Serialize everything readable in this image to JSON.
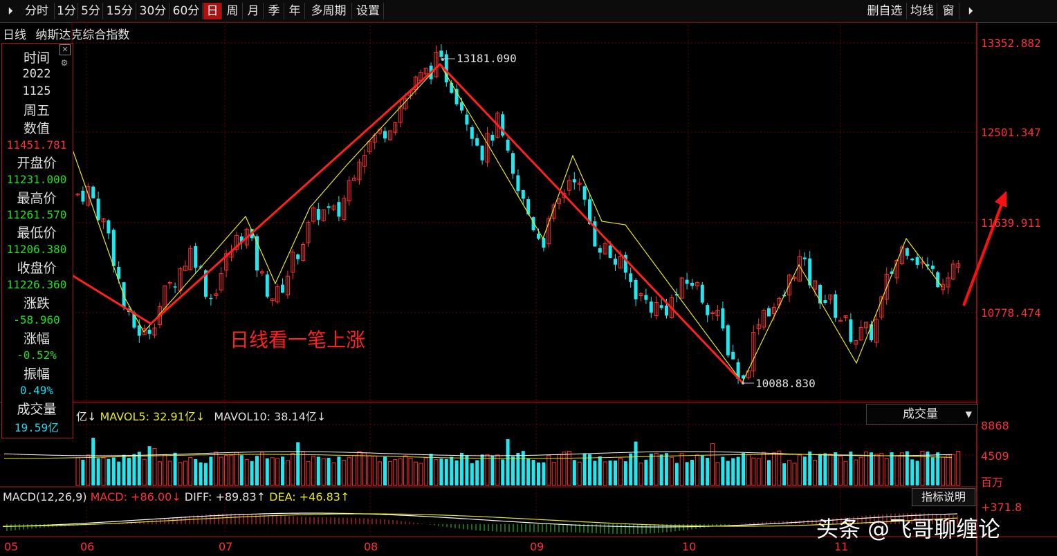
{
  "toolbar": {
    "left_icon": "⏵",
    "periods": [
      "分时",
      "1分",
      "5分",
      "15分",
      "30分",
      "60分",
      "日",
      "周",
      "月",
      "季",
      "年",
      "多周期",
      "设置"
    ],
    "active": "日",
    "right_buttons": [
      "删自选",
      "均线",
      "窗"
    ],
    "right_icon": "⏵"
  },
  "title": {
    "period": "日线",
    "name": "纳斯达克综合指数"
  },
  "info": {
    "time_label": "时间",
    "year": "2022",
    "date": "1125",
    "weekday": "周五",
    "value_label": "数值",
    "value": "11451.781",
    "open_label": "开盘价",
    "open": "11231.000",
    "high_label": "最高价",
    "high": "11261.570",
    "low_label": "最低价",
    "low": "11206.380",
    "close_label": "收盘价",
    "close": "11226.360",
    "change_label": "涨跌",
    "change": "-58.960",
    "pct_label": "涨幅",
    "pct": "-0.52%",
    "amp_label": "振幅",
    "amp": "0.49%",
    "vol_label": "成交量",
    "vol": "19.59亿",
    "close_icon": "close-icon",
    "gear_icon": "gear-icon"
  },
  "price_axis": [
    "13352.882",
    "12501.347",
    "11639.911",
    "10778.474"
  ],
  "annotations": {
    "high": "13181.090",
    "low": "10088.830",
    "text": "日线看一笔上涨"
  },
  "volume": {
    "legend_prefix": "亿↓ ",
    "mavol5": "MAVOL5: 32.91亿↓",
    "mavol10": "MAVOL10: 38.14亿↓",
    "selector": "成交量",
    "axis": [
      "8868",
      "4509",
      "百万"
    ]
  },
  "macd": {
    "name": "MACD(12,26,9)",
    "macd": "MACD: +86.00↓",
    "diff": "DIFF: +89.83↑",
    "dea": "DEA: +46.83↑",
    "button": "指标说明",
    "axis_top": "+371.8"
  },
  "x_axis": [
    "05",
    "06",
    "07",
    "08",
    "09",
    "10",
    "11"
  ],
  "watermark": "头条 @飞哥聊缠论",
  "colors": {
    "up": "#ff3030",
    "down": "#20e8f0",
    "pen_red": "#ff2020",
    "pen_yellow": "#e8e820",
    "grid": "#6a0000"
  },
  "chart_data": {
    "type": "candlestick",
    "y_ticks": [
      13352.882,
      12501.347,
      11639.911,
      10778.474
    ],
    "high_point": 13181.09,
    "low_point": 10088.83,
    "last_bar": {
      "open": 11231.0,
      "high": 11261.57,
      "low": 11206.38,
      "close": 11226.36
    }
  }
}
